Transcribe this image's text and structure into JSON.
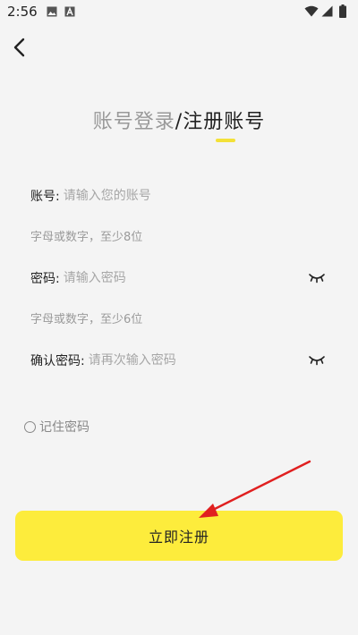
{
  "status_bar": {
    "time": "2:56",
    "icons": [
      "image-icon",
      "a-icon",
      "wifi-icon",
      "signal-icon",
      "battery-icon"
    ]
  },
  "header": {
    "back_icon": "back-arrow-icon"
  },
  "title": {
    "login": "账号登录",
    "separator": "/",
    "register": "注册账号"
  },
  "form": {
    "account": {
      "label": "账号:",
      "placeholder": "请输入您的账号",
      "hint": "字母或数字，至少8位"
    },
    "password": {
      "label": "密码:",
      "placeholder": "请输入密码",
      "hint": "字母或数字，至少6位",
      "toggle_icon": "eye-closed-icon"
    },
    "confirm": {
      "label": "确认密码:",
      "placeholder": "请再次输入密码",
      "toggle_icon": "eye-closed-icon"
    },
    "remember_label": "记住密码",
    "remember_checked": false,
    "submit_label": "立即注册"
  },
  "colors": {
    "accent": "#fdec3c",
    "underline": "#f3e138",
    "annotation_arrow": "#e02020"
  }
}
